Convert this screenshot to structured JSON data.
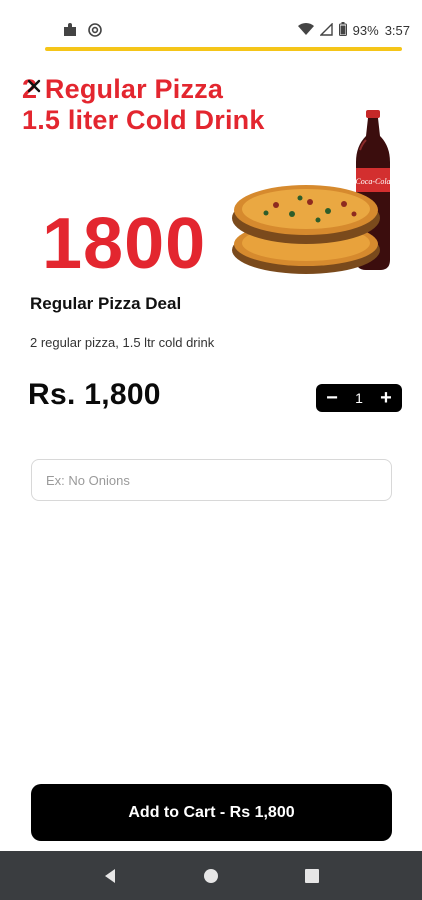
{
  "status_bar": {
    "battery": "93%",
    "time": "3:57",
    "icons": [
      "puzzle-icon",
      "at-sign-icon",
      "wifi-icon",
      "signal-icon",
      "battery-icon"
    ]
  },
  "banner": {
    "headline_line1": "2 Regular Pizza",
    "headline_line2": "1.5 liter Cold Drink",
    "price_badge": "1800",
    "bottle_label": "Coca-Cola"
  },
  "product": {
    "title": "Regular Pizza Deal",
    "description": "2 regular pizza, 1.5 ltr cold drink",
    "price": "Rs. 1,800",
    "quantity": "1",
    "minus_label": "−",
    "plus_label": "+"
  },
  "notes": {
    "placeholder": "Ex: No Onions"
  },
  "cart": {
    "button_label": "Add to Cart - Rs 1,800"
  },
  "colors": {
    "accent_red": "#e3262f",
    "accent_yellow": "#f5c518",
    "button_black": "#000000",
    "nav_bar": "#3a3d40"
  }
}
